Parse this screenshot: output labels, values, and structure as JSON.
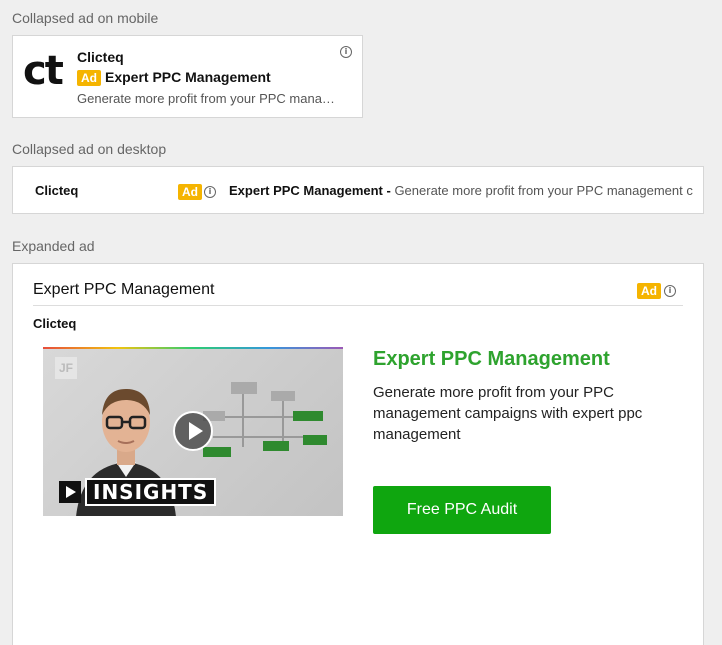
{
  "labels": {
    "mobile": "Collapsed ad on mobile",
    "desktop": "Collapsed ad on desktop",
    "expanded": "Expanded ad"
  },
  "ad_badge": "Ad",
  "info_glyph": "i",
  "mobile_ad": {
    "logo_text": "ct",
    "advertiser": "Clicteq",
    "headline": "Expert PPC Management",
    "description": "Generate more profit from your PPC mana…"
  },
  "desktop_ad": {
    "advertiser": "Clicteq",
    "headline": "Expert PPC Management -",
    "description": " Generate more profit from your PPC management c"
  },
  "expanded_ad": {
    "headline": "Expert PPC Management",
    "advertiser": "Clicteq",
    "video": {
      "corner_logo": "JF",
      "brand_text": "INSIGHTS"
    },
    "title": "Expert PPC Management",
    "description": "Generate more profit from your PPC management campaigns with expert ppc management",
    "cta_label": "Free PPC Audit"
  },
  "colors": {
    "ad_badge": "#f5b400",
    "accent_green": "#2ea32e",
    "cta_green": "#0fa60f"
  }
}
